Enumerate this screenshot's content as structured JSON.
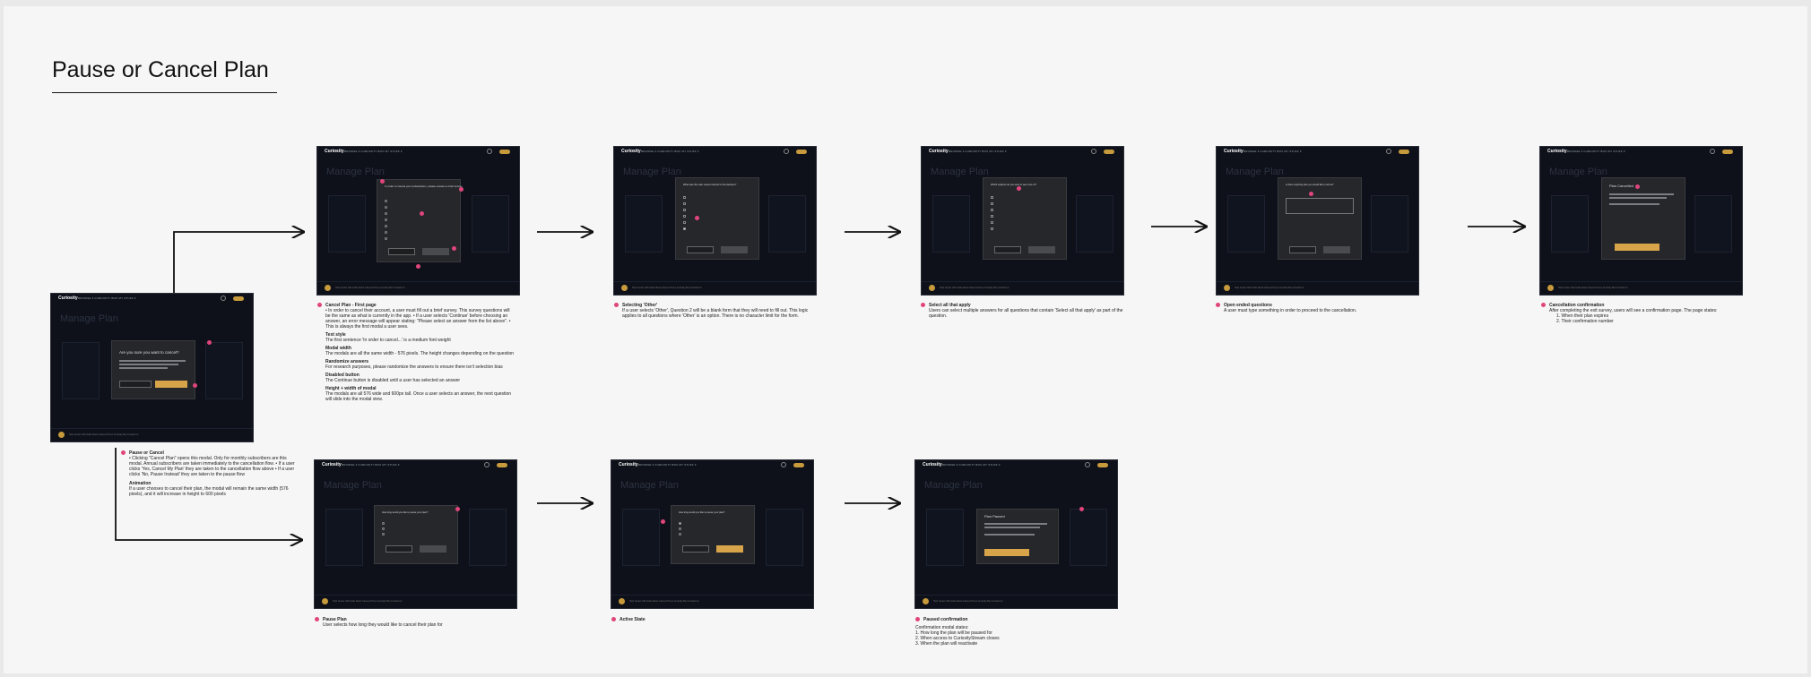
{
  "page": {
    "title": "Pause or Cancel Plan"
  },
  "app": {
    "logo": "Curiosity",
    "nav_links": "BROWSE ▾   CURIOSITY BOX   MY STUFF ▾",
    "page_title": "Manage Plan",
    "footer_links": "Help Center   Gift Cards   About   Careers   Press   Curiosity Box   Contact Us",
    "plan_price": "$99"
  },
  "screens": {
    "pause_or_cancel": {
      "question": "Are you sure you want to cancel?",
      "primary": "No, Pause Instead",
      "secondary": "Yes, Cancel My Plan"
    },
    "cancel_first": {
      "question": "In order to cancel your subscription, please answer a brief survey."
    },
    "selecting_other": {
      "question": "What was the main reason that led to this decision?"
    },
    "select_all": {
      "question": "Which subjects do you want to see more of?"
    },
    "open_ended": {
      "question": "Is there anything else you would like to tell us?"
    },
    "cancel_confirm": {
      "title": "Plan Cancelled",
      "button": "Return to Account Page"
    },
    "pause_plan": {
      "question": "How long would you like to pause your plan?"
    },
    "active_state": {
      "question": "How long would you like to pause your plan?"
    },
    "paused_confirm": {
      "title": "Plan Paused",
      "button": "Return to Account Page"
    }
  },
  "notes": {
    "pause_or_cancel": {
      "heading": "Pause or Cancel",
      "body": "• Clicking \"Cancel Plan\" opens this modal. Only for monthly subscribers are this modal. Annual subscribers are taken immediately to the cancellation flow. • If a user clicks 'Yes, Cancel My Plan' they are taken to the cancellation flow above • If a user clicks 'No, Pause Instead' they are taken to the pause flow",
      "heading2": "Animation",
      "body2": "If a user chooses to cancel their plan, the modal will remain the same width (576 pixels), and it will increase in height to 600 pixels"
    },
    "cancel_first": {
      "h1": "Cancel Plan - First page",
      "b1": "• In order to cancel their account, a user must fill out a brief survey. This survey questions will be the same as what is currently in the app. • If a user selects 'Continue' before choosing an answer, an error message will appear stating: \"Please select an answer from the list above\". • This is always the first modal a user sees.",
      "h2": "Text style",
      "b2": "The first sentence 'In order to cancel...' is a medium font weight",
      "h3": "Modal width",
      "b3": "The modals are all the same width - 576 pixels. The height changes depending on the question",
      "h4": "Randomize answers",
      "b4": "For research purposes, please randomize the answers to ensure there isn't selection bias",
      "h5": "Disabled button",
      "b5": "The Continue button is disabled until a user has selected an answer",
      "h6": "Height + width of modal",
      "b6": "The modals are all 576 wide and 600px tall. Once a user selects an answer, the next question will slide into the modal view."
    },
    "selecting_other": {
      "heading": "Selecting 'Other'",
      "body": "If a user selects 'Other', Question 2 will be a blank form that they will need to fill out. This logic applies to all questions where 'Other' is an option. There is no character limit for the form."
    },
    "select_all": {
      "heading": "Select all that apply",
      "body": "Users can select multiple answers for all questions that contain 'Select all that apply' as part of the question."
    },
    "open_ended": {
      "heading": "Open ended questions",
      "body": "A user must type something in order to proceed to the cancellation."
    },
    "cancel_confirm": {
      "heading": "Cancellation confirmation",
      "body": "After completing the exit survey, users will see a confirmation page. The page states:",
      "items": [
        "1. When their plan expires",
        "2. Their confirmation number"
      ]
    },
    "pause_plan": {
      "heading": "Pause Plan",
      "body": "User selects how long they would like to cancel their plan for"
    },
    "active_state": {
      "heading": "Active State"
    },
    "paused_confirm": {
      "heading": "Paused confirmation",
      "body": "Confirmation modal states:",
      "items": [
        "1. How long the plan will be paused for",
        "2. When access to CuriosityStream closes",
        "3. When the plan will reactivate"
      ]
    }
  }
}
